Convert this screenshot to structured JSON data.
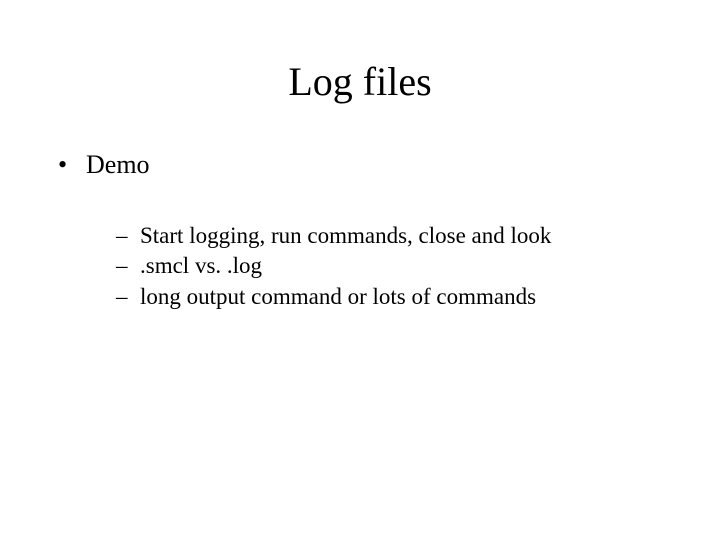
{
  "title": "Log files",
  "bullets": {
    "level1": [
      {
        "label": "Demo"
      }
    ],
    "level2": [
      {
        "label": "Start logging, run commands, close and look"
      },
      {
        "label": ".smcl vs. .log"
      },
      {
        "label": "long output command or lots of commands"
      }
    ]
  }
}
